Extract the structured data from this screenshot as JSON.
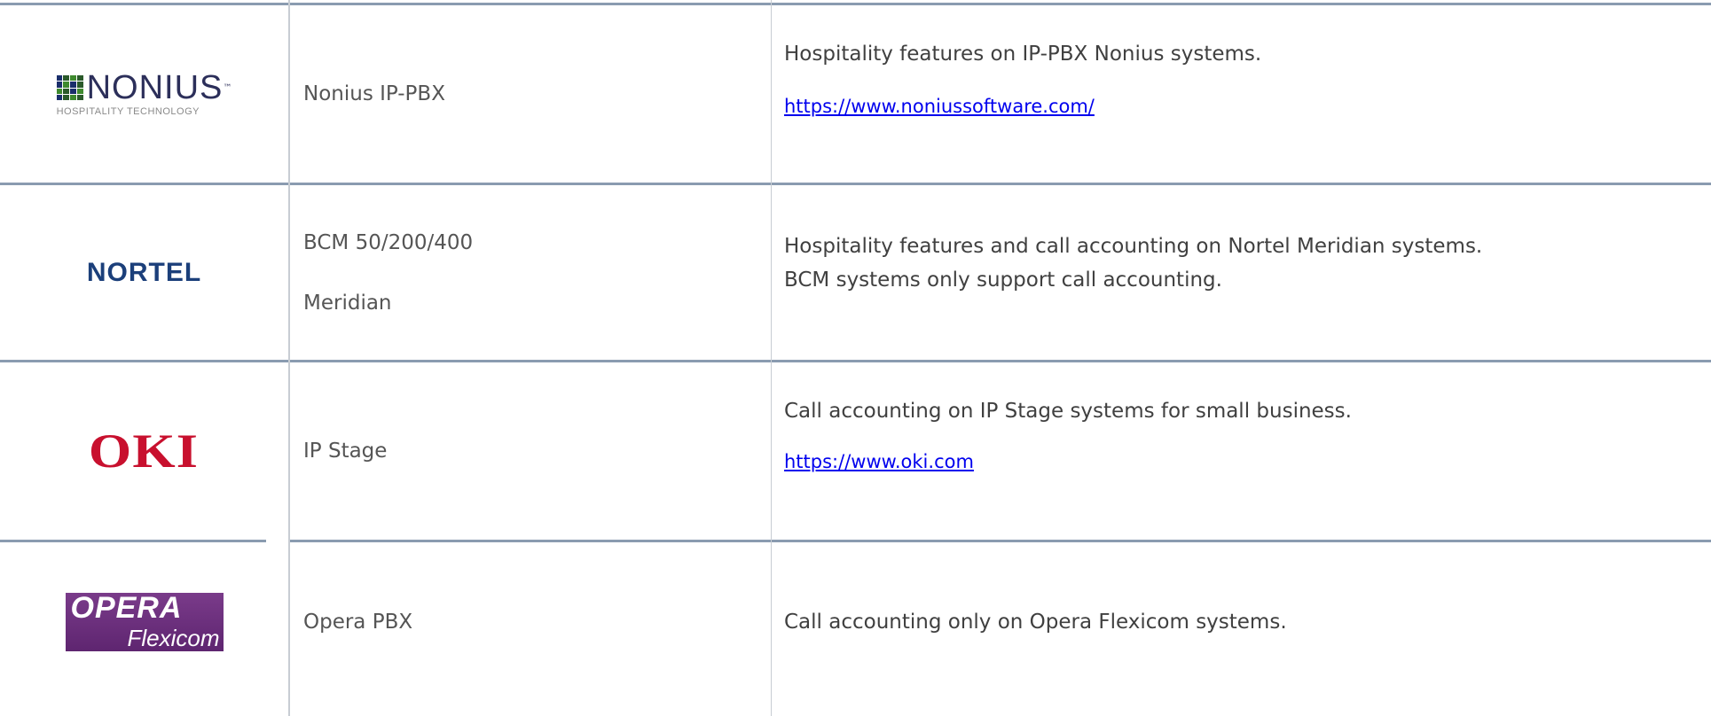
{
  "rows": [
    {
      "logo": {
        "icon": "nonius-logo",
        "word": "NONIUS",
        "tm": "™",
        "sub": "HOSPITALITY TECHNOLOGY"
      },
      "names": [
        "Nonius IP-PBX"
      ],
      "description": [
        "Hospitality features on IP-PBX Nonius systems."
      ],
      "link": "https://www.noniussoftware.com/"
    },
    {
      "logo": {
        "icon": "nortel-logo",
        "word": "NORTEL"
      },
      "names": [
        "BCM 50/200/400",
        "Meridian"
      ],
      "description": [
        "Hospitality features and call accounting on Nortel Meridian systems.",
        "BCM systems only support call accounting."
      ],
      "link": ""
    },
    {
      "logo": {
        "icon": "oki-logo",
        "word": "OKI"
      },
      "names": [
        "IP Stage"
      ],
      "description": [
        "Call accounting on IP Stage systems for small business."
      ],
      "link": "https://www.oki.com"
    },
    {
      "logo": {
        "icon": "opera-flexicom-logo",
        "word1": "OPERA",
        "word2": "Flexicom"
      },
      "names": [
        "Opera PBX"
      ],
      "description": [
        "Call accounting only on Opera Flexicom systems."
      ],
      "link": ""
    }
  ],
  "colors": {
    "divider": "#8a9bb0",
    "link": "#0000ee",
    "oki_red": "#c8102e",
    "nortel_blue": "#1b3f7a",
    "opera_purple": "#6a2d7c"
  }
}
